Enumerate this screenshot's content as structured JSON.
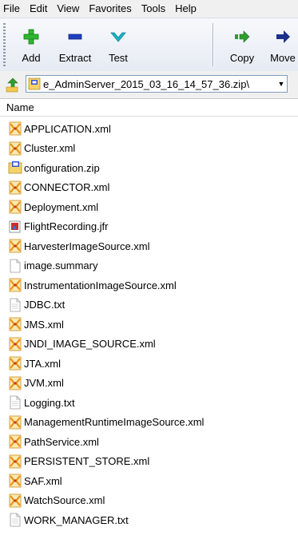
{
  "menu": [
    "File",
    "Edit",
    "View",
    "Favorites",
    "Tools",
    "Help"
  ],
  "toolbar": {
    "add_label": "Add",
    "extract_label": "Extract",
    "test_label": "Test",
    "copy_label": "Copy",
    "move_label": "Move"
  },
  "address": {
    "path": "e_AdminServer_2015_03_16_14_57_36.zip\\"
  },
  "list": {
    "column_name": "Name",
    "files": [
      {
        "name": "APPLICATION.xml",
        "icon": "xml-file-icon"
      },
      {
        "name": "Cluster.xml",
        "icon": "xml-file-icon"
      },
      {
        "name": "configuration.zip",
        "icon": "zip-folder-icon"
      },
      {
        "name": "CONNECTOR.xml",
        "icon": "xml-file-icon"
      },
      {
        "name": "Deployment.xml",
        "icon": "xml-file-icon"
      },
      {
        "name": "FlightRecording.jfr",
        "icon": "jfr-file-icon"
      },
      {
        "name": "HarvesterImageSource.xml",
        "icon": "xml-file-icon"
      },
      {
        "name": "image.summary",
        "icon": "blank-file-icon"
      },
      {
        "name": "InstrumentationImageSource.xml",
        "icon": "xml-file-icon"
      },
      {
        "name": "JDBC.txt",
        "icon": "text-file-icon"
      },
      {
        "name": "JMS.xml",
        "icon": "xml-file-icon"
      },
      {
        "name": "JNDI_IMAGE_SOURCE.xml",
        "icon": "xml-file-icon"
      },
      {
        "name": "JTA.xml",
        "icon": "xml-file-icon"
      },
      {
        "name": "JVM.xml",
        "icon": "xml-file-icon"
      },
      {
        "name": "Logging.txt",
        "icon": "text-file-icon"
      },
      {
        "name": "ManagementRuntimeImageSource.xml",
        "icon": "xml-file-icon"
      },
      {
        "name": "PathService.xml",
        "icon": "xml-file-icon"
      },
      {
        "name": "PERSISTENT_STORE.xml",
        "icon": "xml-file-icon"
      },
      {
        "name": "SAF.xml",
        "icon": "xml-file-icon"
      },
      {
        "name": "WatchSource.xml",
        "icon": "xml-file-icon"
      },
      {
        "name": "WORK_MANAGER.txt",
        "icon": "text-file-icon"
      }
    ]
  },
  "colors": {
    "add_green": "#2fb52f",
    "extract_blue": "#1f3fbf",
    "test_teal": "#19b6c9",
    "arrow_green": "#2f9e2f",
    "arrow_navy": "#1c2f8a",
    "xml_orange": "#f0a020"
  }
}
